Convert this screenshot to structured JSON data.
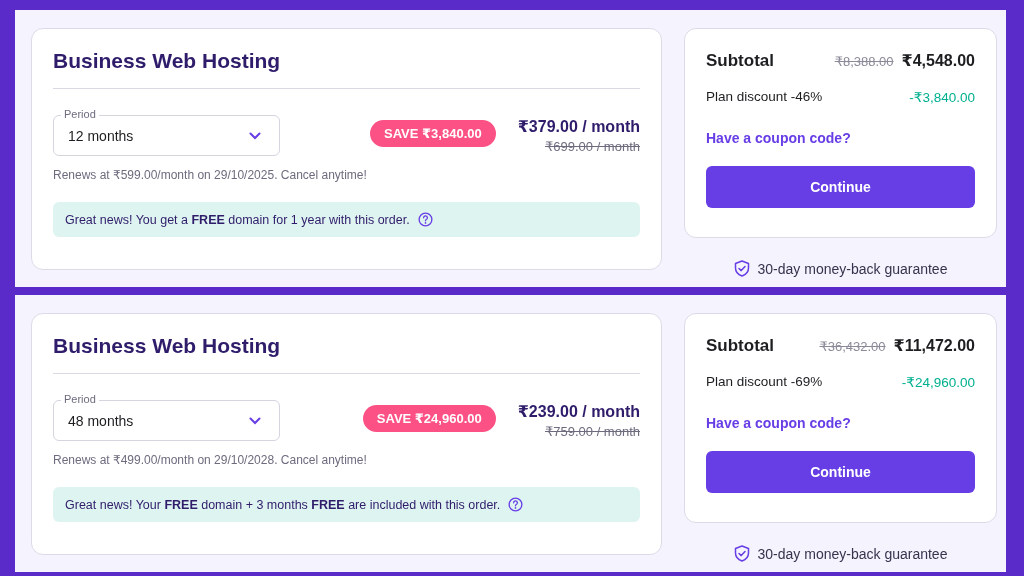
{
  "panels": [
    {
      "title": "Business Web Hosting",
      "period": {
        "label": "Period",
        "value": "12 months"
      },
      "save_badge": "SAVE ₹3,840.00",
      "price": "₹379.00 / month",
      "old_price": "₹699.00 / month",
      "renews": "Renews at ₹599.00/month on 29/10/2025. Cancel anytime!",
      "notice": "Great news! You get a **FREE** domain for 1 year with this order.",
      "subtotal": {
        "label": "Subtotal",
        "old": "₹8,388.00",
        "new": "₹4,548.00"
      },
      "discount": {
        "label": "Plan discount -46%",
        "amount": "-₹3,840.00"
      },
      "coupon_link": "Have a coupon code?",
      "continue_button": "Continue",
      "guarantee": "30-day money-back guarantee"
    },
    {
      "title": "Business Web Hosting",
      "period": {
        "label": "Period",
        "value": "48 months"
      },
      "save_badge": "SAVE ₹24,960.00",
      "price": "₹239.00 / month",
      "old_price": "₹759.00 / month",
      "renews": "Renews at ₹499.00/month on 29/10/2028. Cancel anytime!",
      "notice": "Great news! Your **FREE** domain + 3 months **FREE** are included with this order.",
      "subtotal": {
        "label": "Subtotal",
        "old": "₹36,432.00",
        "new": "₹11,472.00"
      },
      "discount": {
        "label": "Plan discount -69%",
        "amount": "-₹24,960.00"
      },
      "coupon_link": "Have a coupon code?",
      "continue_button": "Continue",
      "guarantee": "30-day money-back guarantee"
    }
  ]
}
